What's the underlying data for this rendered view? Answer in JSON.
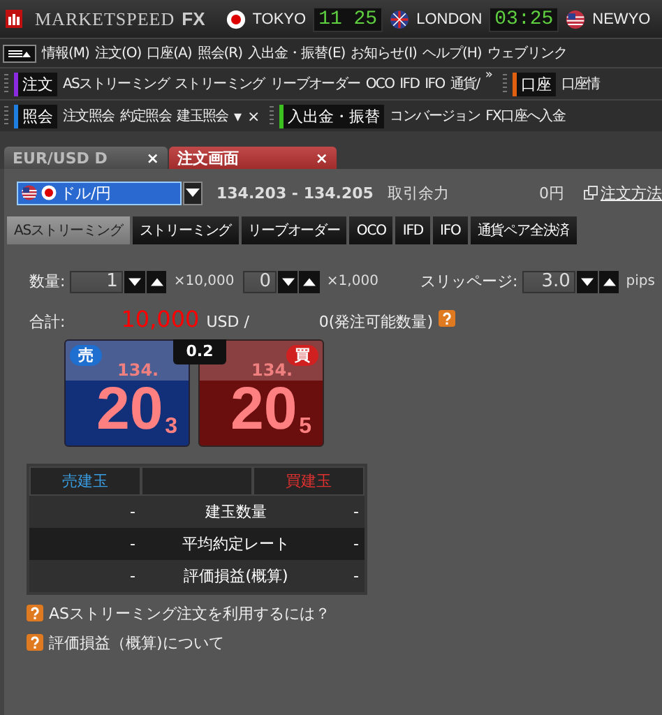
{
  "header": {
    "brand": "MARKETSPEED",
    "brand_suffix": "FX",
    "clocks": [
      {
        "city": "TOKYO",
        "time": "11 25",
        "kind": "jp"
      },
      {
        "city": "LONDON",
        "time": "03:25",
        "kind": "uk"
      },
      {
        "city": "NEWYO",
        "kind": "us"
      }
    ]
  },
  "menu": [
    "情報(M)",
    "注文(O)",
    "口座(A)",
    "照会(R)",
    "入出金・振替(E)",
    "お知らせ(I)",
    "ヘルプ(H)",
    "ウェブリンク"
  ],
  "toolbars": [
    {
      "groups": [
        {
          "title": "注文",
          "color": "#8a2be2",
          "items": [
            "ASストリーミング",
            "ストリーミング",
            "リーブオーダー",
            "OCO",
            "IFD",
            "IFO",
            "通貨/"
          ],
          "more": "»"
        },
        {
          "title": "口座",
          "color": "#e06010",
          "items": [
            "口座情"
          ]
        }
      ]
    },
    {
      "groups": [
        {
          "title": "照会",
          "color": "#1e7fe0",
          "items": [
            "注文照会",
            "約定照会",
            "建玉照会"
          ],
          "dropdown": "▾",
          "close": "×"
        },
        {
          "title": "入出金・振替",
          "color": "#3cc020",
          "items": [
            "コンバージョン",
            "FX口座へ入金"
          ]
        }
      ]
    }
  ],
  "doc_tabs": [
    {
      "label": "EUR/USD D",
      "close": "×",
      "selected": false
    },
    {
      "label": "注文画面",
      "close": "×",
      "selected": true
    }
  ],
  "currency": {
    "value": "ドル/円",
    "rate": "134.203 - 134.205",
    "margin_label": "取引余力",
    "margin_value": "0円",
    "link": "注文方法"
  },
  "order_tabs": [
    {
      "label": "ASストリーミング",
      "selected": true
    },
    {
      "label": "ストリーミング",
      "selected": false
    },
    {
      "label": "リーブオーダー",
      "selected": false
    },
    {
      "label": "OCO",
      "selected": false
    },
    {
      "label": "IFD",
      "selected": false
    },
    {
      "label": "IFO",
      "selected": false
    },
    {
      "label": "通貨ペア全決済",
      "selected": false
    }
  ],
  "quantity": {
    "label": "数量:",
    "spinners": [
      {
        "value": "1",
        "unit": "×10,000"
      },
      {
        "value": "0",
        "unit": "×1,000"
      }
    ],
    "slippage_label": "スリッページ:",
    "slippage": {
      "value": "3.0",
      "unit": "pips"
    }
  },
  "total": {
    "label": "合計:",
    "value": "10,000",
    "unit": "USD /",
    "available": "0(発注可能数量)"
  },
  "prices": {
    "spread": "0.2",
    "tiles": [
      {
        "kind": "sell",
        "badge": "売",
        "prefix": "134.",
        "main": "20",
        "pip": "3"
      },
      {
        "kind": "buy",
        "badge": "買",
        "prefix": "134.",
        "main": "20",
        "pip": "5"
      }
    ]
  },
  "positions": {
    "columns": [
      "売建玉",
      "",
      "買建玉"
    ],
    "rows": [
      {
        "sell": "-",
        "label": "建玉数量",
        "buy": "-"
      },
      {
        "sell": "-",
        "label": "平均約定レート",
        "buy": "-"
      },
      {
        "sell": "-",
        "label": "評価損益(概算)",
        "buy": "-"
      }
    ]
  },
  "help_links": [
    "ASストリーミング注文を利用するには？",
    "評価損益（概算)について"
  ]
}
